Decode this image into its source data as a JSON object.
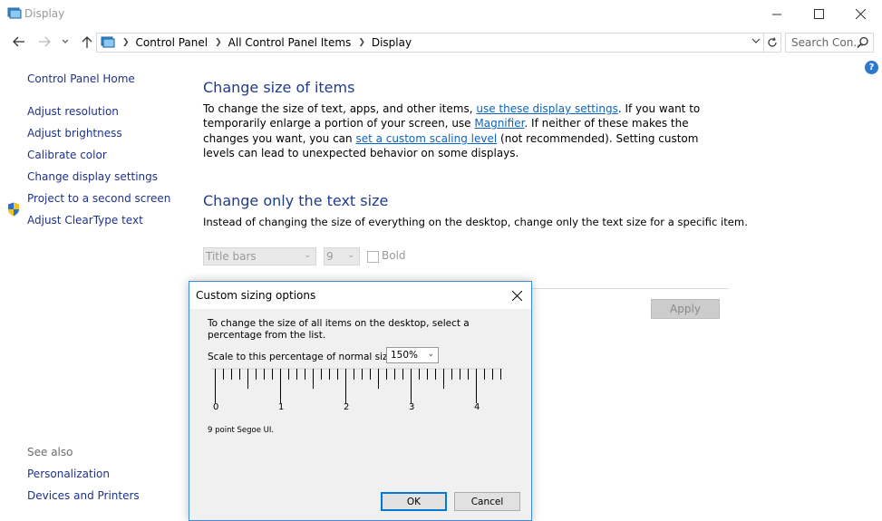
{
  "window": {
    "title": "Display"
  },
  "address": {
    "crumbs": [
      "Control Panel",
      "All Control Panel Items",
      "Display"
    ],
    "search_placeholder": "Search Con..."
  },
  "sidebar": {
    "home": "Control Panel Home",
    "items": [
      "Adjust resolution",
      "Adjust brightness",
      "Calibrate color",
      "Change display settings",
      "Project to a second screen",
      "Adjust ClearType text"
    ],
    "see_also_heading": "See also",
    "see_also": [
      "Personalization",
      "Devices and Printers"
    ]
  },
  "main": {
    "size_heading": "Change size of items",
    "size_text": {
      "t1": "To change the size of text, apps, and other items, ",
      "link1": "use these display settings",
      "t2": ".  If you want to temporarily enlarge a portion of your screen, use ",
      "link2": "Magnifier",
      "t3": ".  If neither of these makes the changes you want, you can ",
      "link3": "set a custom scaling level",
      "t4": " (not recommended).  Setting custom levels can lead to unexpected behavior on some displays."
    },
    "text_heading": "Change only the text size",
    "text_desc": "Instead of changing the size of everything on the desktop, change only the text size for a specific item.",
    "item_select": "Title bars",
    "size_select": "9",
    "bold_label": "Bold",
    "apply_label": "Apply"
  },
  "dialog": {
    "title": "Custom sizing options",
    "instruction": "To change the size of all items on the desktop, select a percentage from the list.",
    "scale_label": "Scale to this percentage of normal size:",
    "scale_value": "150%",
    "ruler_numbers": [
      "0",
      "1",
      "2",
      "3",
      "4"
    ],
    "font_note": "9 point Segoe UI.",
    "ok_label": "OK",
    "cancel_label": "Cancel"
  },
  "colors": {
    "link": "#0b63c4",
    "heading": "#1e3c8c",
    "nav_link": "#1e3287",
    "dialog_border": "#3c8bd9"
  }
}
